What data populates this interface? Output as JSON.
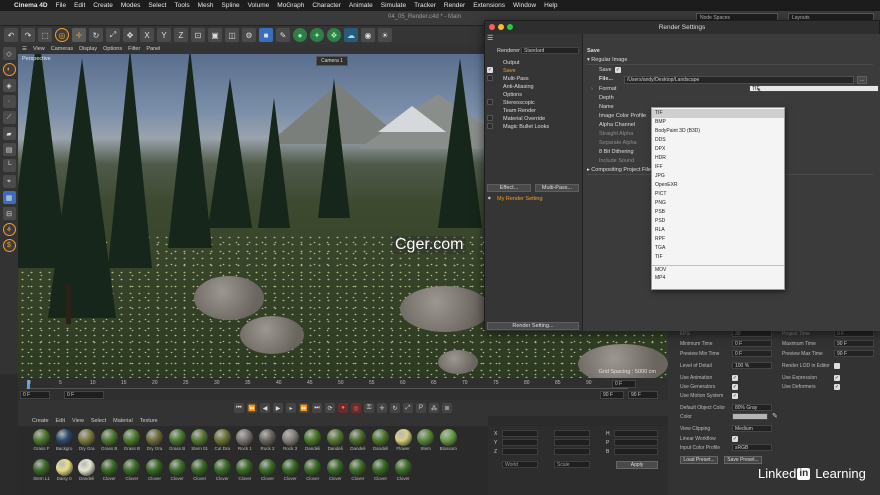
{
  "menubar": {
    "items": [
      "Cinema 4D",
      "File",
      "Edit",
      "Create",
      "Modes",
      "Select",
      "Tools",
      "Mesh",
      "Spline",
      "Volume",
      "MoGraph",
      "Character",
      "Animate",
      "Simulate",
      "Tracker",
      "Render",
      "Extensions",
      "Window",
      "Help"
    ]
  },
  "window": {
    "document": "04_05_Render.c4d * - Main",
    "node_spaces": "Node Spaces",
    "layouts": "Layouts"
  },
  "viewport": {
    "menu": [
      "View",
      "Cameras",
      "Display",
      "Options",
      "Filter",
      "Panel"
    ],
    "label": "Perspective",
    "camera": "Camera 1",
    "grid_spacing": "Grid Spacing : 5000 cm",
    "watermarks": [
      "Cger.com",
      "Cger.com"
    ]
  },
  "timeline": {
    "ticks": [
      "0",
      "5",
      "10",
      "15",
      "20",
      "25",
      "30",
      "35",
      "40",
      "45",
      "50",
      "55",
      "60",
      "65",
      "70",
      "75",
      "80",
      "85",
      "90"
    ],
    "current_frame": "0 F",
    "start": "0 F",
    "start2": "0 F",
    "end": "90 F",
    "end2": "90 F"
  },
  "materials": {
    "menu": [
      "Create",
      "Edit",
      "View",
      "Select",
      "Material",
      "Texture"
    ],
    "row1": [
      "Grass F",
      "Backgro",
      "Dry Gra",
      "Grass B",
      "Grass B",
      "Dry Gra",
      "Grass B",
      "Stem 01",
      "Cut Dra",
      "Rock 1",
      "Rock 2",
      "Rock 3",
      "Dandeli",
      "Dandeli",
      "Dandeli",
      "Dandeli",
      "Flower",
      "Stem",
      "Blossom"
    ],
    "row2": [
      "Stem L1",
      "Daisy 0",
      "Dandeli",
      "Clover",
      "Clover",
      "Clover",
      "Clover",
      "Clover",
      "Clover",
      "Clover",
      "Clover",
      "Clover",
      "Clover",
      "Clover",
      "Clover",
      "Clover",
      "Clover"
    ]
  },
  "coords": {
    "labels": [
      "X",
      "Y",
      "Z",
      "H",
      "P",
      "B"
    ],
    "values": [
      "0 cm",
      "0 cm",
      "0 cm",
      "0 cm",
      "0 cm",
      "0 cm",
      "0 °",
      "0 °",
      "0 °"
    ],
    "world": "World",
    "scale": "Scale",
    "apply": "Apply"
  },
  "attributes": {
    "fps_label": "FPS",
    "fps": "30",
    "project_time_label": "Project Time",
    "project_time": "0 F",
    "min_time_label": "Minimum Time",
    "min_time": "0 F",
    "max_time_label": "Maximum Time",
    "max_time": "90 F",
    "preview_min_label": "Preview Min Time",
    "preview_min": "0 F",
    "preview_max_label": "Preview Max Time",
    "preview_max": "90 F",
    "lod_label": "Level of Detail",
    "lod": "100 %",
    "render_lod_label": "Render LOD in Editor",
    "use_animation": "Use Animation",
    "use_expression": "Use Expression",
    "use_generators": "Use Generators",
    "use_deformers": "Use Deformers",
    "use_motion": "Use Motion System",
    "default_obj_color_label": "Default Object Color",
    "default_obj_color": "80% Gray",
    "color_label": "Color",
    "view_clipping_label": "View Clipping",
    "view_clipping": "Medium",
    "linear_workflow": "Linear Workflow",
    "input_color_profile_label": "Input Color Profile",
    "input_color_profile": "sRGB",
    "load_preset": "Load Preset...",
    "save_preset": "Save Preset..."
  },
  "dialog": {
    "title": "Render Settings",
    "renderer_label": "Renderer",
    "renderer": "Standard",
    "left_items": [
      "Output",
      "Save",
      "Multi-Pass",
      "Anti-Aliasing",
      "Options",
      "Stereoscopic",
      "Team Render",
      "Material Override",
      "Magic Bullet Looks"
    ],
    "effect_button": "Effect...",
    "multipass_button": "Multi-Pass...",
    "my_render_setting": "My Render Setting",
    "render_setting_button": "Render Setting...",
    "section_title": "Save",
    "regular_image": "Regular Image",
    "save_label": "Save",
    "file_label": "File...",
    "file_path": "/Users/andy/Desktop/Landscape",
    "fields": [
      "Format",
      "Depth",
      "Name",
      "Image Color Profile",
      "Alpha Channel",
      "Straight Alpha",
      "Separate Alpha",
      "8 Bit Dithering",
      "Include Sound"
    ],
    "compositing": "Compositing Project File",
    "format_options": [
      "TIF",
      "BMP",
      "BodyPaint 3D (B3D)",
      "DDS",
      "DPX",
      "HDR",
      "IFF",
      "JPG",
      "OpenEXR",
      "PICT",
      "PNG",
      "PSB",
      "PSD",
      "RLA",
      "RPF",
      "TGA",
      "TIF",
      "MOV",
      "MP4"
    ]
  },
  "branding": {
    "linkedin_word1": "Linked",
    "linkedin_in": "in",
    "linkedin_word2": "Learning"
  }
}
